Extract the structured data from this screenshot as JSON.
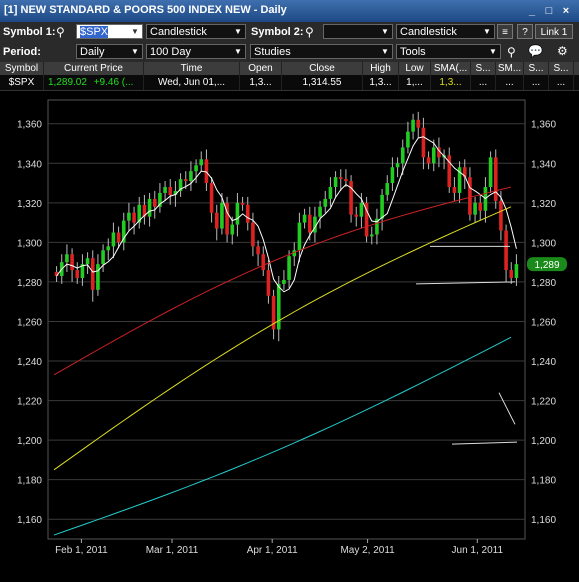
{
  "window": {
    "title": "[1] NEW STANDARD & POORS 500 INDEX NEW - Daily",
    "min_label": "_",
    "max_label": "□",
    "close_label": "×"
  },
  "toolbar": {
    "symbol1_label": "Symbol 1:",
    "symbol1_value": "$SPX",
    "chart_type1": "Candlestick",
    "symbol2_label": "Symbol 2:",
    "symbol2_value": "",
    "chart_type2": "Candlestick",
    "period_label": "Period:",
    "period_value": "Daily",
    "range_value": "100 Day",
    "studies_label": "Studies",
    "tools_label": "Tools",
    "help_label": "?",
    "link_label": "Link 1"
  },
  "quote": {
    "headers": [
      "Symbol",
      "Current Price",
      "Time",
      "Open",
      "Close",
      "High",
      "Low",
      "SMA(...",
      "S...",
      "SM...",
      "S...",
      "S..."
    ],
    "symbol": "$SPX",
    "price": "1,289.02",
    "change": "+9.46 (...",
    "time": "Wed, Jun 01,...",
    "open": "1,3...",
    "close": "1,314.55",
    "high": "1,3...",
    "low": "1,...",
    "sma": "1,3...",
    "c9": "...",
    "c10": "...",
    "c11": "...",
    "c12": "..."
  },
  "chart_data": {
    "type": "candlestick",
    "ylim": [
      1150,
      1372
    ],
    "yticks": [
      "1,160",
      "1,180",
      "1,200",
      "1,220",
      "1,240",
      "1,260",
      "1,280",
      "1,300",
      "1,320",
      "1,340",
      "1,360"
    ],
    "xticks": [
      "Feb 1, 2011",
      "Mar 1, 2011",
      "Apr 1, 2011",
      "May 2, 2011",
      "Jun 1, 2011"
    ],
    "last_label": "1,289",
    "colors": {
      "up": "#22cc22",
      "down": "#dd2222",
      "sma_short": "#ffffff",
      "sma_mid": "#cc2222",
      "sma_long": "#dddd22",
      "sma_longest": "#22cccc",
      "grid": "#3a3a3a",
      "last_badge": "#1a8a1a"
    },
    "candles_close": [
      1283,
      1290,
      1294,
      1286,
      1282,
      1289,
      1292,
      1276,
      1289,
      1296,
      1298,
      1305,
      1300,
      1311,
      1315,
      1310,
      1319,
      1313,
      1322,
      1318,
      1325,
      1328,
      1324,
      1326,
      1332,
      1331,
      1336,
      1339,
      1342,
      1330,
      1315,
      1307,
      1320,
      1304,
      1309,
      1320,
      1319,
      1310,
      1298,
      1294,
      1286,
      1273,
      1256,
      1279,
      1281,
      1293,
      1296,
      1310,
      1314,
      1305,
      1313,
      1318,
      1322,
      1328,
      1333,
      1332,
      1331,
      1314,
      1313,
      1320,
      1303,
      1304,
      1312,
      1324,
      1330,
      1338,
      1340,
      1348,
      1356,
      1362,
      1358,
      1343,
      1340,
      1348,
      1343,
      1344,
      1328,
      1325,
      1338,
      1333,
      1314,
      1320,
      1316,
      1328,
      1343,
      1321,
      1306,
      1286,
      1282,
      1289
    ],
    "candles_open": [
      1285,
      1283,
      1290,
      1294,
      1286,
      1282,
      1289,
      1292,
      1276,
      1289,
      1296,
      1298,
      1305,
      1300,
      1311,
      1315,
      1310,
      1319,
      1313,
      1322,
      1318,
      1325,
      1328,
      1324,
      1326,
      1332,
      1331,
      1336,
      1339,
      1342,
      1330,
      1315,
      1307,
      1320,
      1304,
      1309,
      1320,
      1319,
      1310,
      1298,
      1294,
      1286,
      1273,
      1256,
      1279,
      1281,
      1293,
      1296,
      1310,
      1314,
      1305,
      1313,
      1318,
      1322,
      1328,
      1333,
      1332,
      1331,
      1314,
      1313,
      1320,
      1303,
      1304,
      1312,
      1324,
      1330,
      1338,
      1340,
      1348,
      1356,
      1362,
      1358,
      1343,
      1340,
      1348,
      1343,
      1344,
      1328,
      1325,
      1338,
      1333,
      1314,
      1320,
      1316,
      1328,
      1343,
      1321,
      1306,
      1286,
      1282
    ],
    "sma_short_endpoints": [
      1279,
      1296
    ],
    "sma_mid_endpoints": [
      1233,
      1328
    ],
    "sma_long_endpoints": [
      1185,
      1318
    ],
    "sma_longest_endpoints": [
      1152,
      1252
    ]
  }
}
